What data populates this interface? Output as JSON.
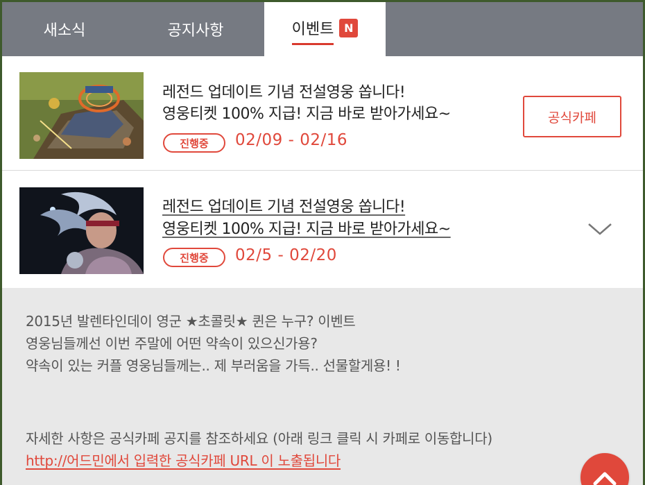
{
  "tabs": [
    {
      "label": "새소식"
    },
    {
      "label": "공지사항"
    },
    {
      "label": "이벤트",
      "badge": "N",
      "active": true
    }
  ],
  "events": [
    {
      "title_line1": "레전드 업데이트 기념 전설영웅 쏩니다!",
      "title_line2": "영웅티켓 100% 지급! 지금 바로 받아가세요~",
      "status": "진행중",
      "date": "02/09 - 02/16",
      "button_label": "공식카페"
    },
    {
      "title_line1": "레전드 업데이트 기념 전설영웅 쏩니다!",
      "title_line2": "영웅티켓 100% 지급! 지금 바로 받아가세요~",
      "status": "진행중",
      "date": "02/5 - 02/20",
      "expand_icon": "chevron-down-icon"
    }
  ],
  "detail": {
    "line1": "2015년 발렌타인데이 영군 ★초콜릿★ 퀸은 누구?  이벤트",
    "line2": "영웅님들께선 이번 주말에 어떤 약속이 있으신가용?",
    "line3": "약속이 있는 커플 영웅님들께는.. 제 부러움을 가득.. 선물할게용! !",
    "line4": "자세한 사항은 공식카페 공지를 참조하세요 (아래 링크 클릭 시 카페로 이동합니다)",
    "link": "http://어드민에서 입력한 공식카페 URL 이 노출됩니다"
  },
  "colors": {
    "accent": "#e0483b",
    "tab_bar": "#767a82",
    "detail_bg": "#e8e8e8"
  }
}
